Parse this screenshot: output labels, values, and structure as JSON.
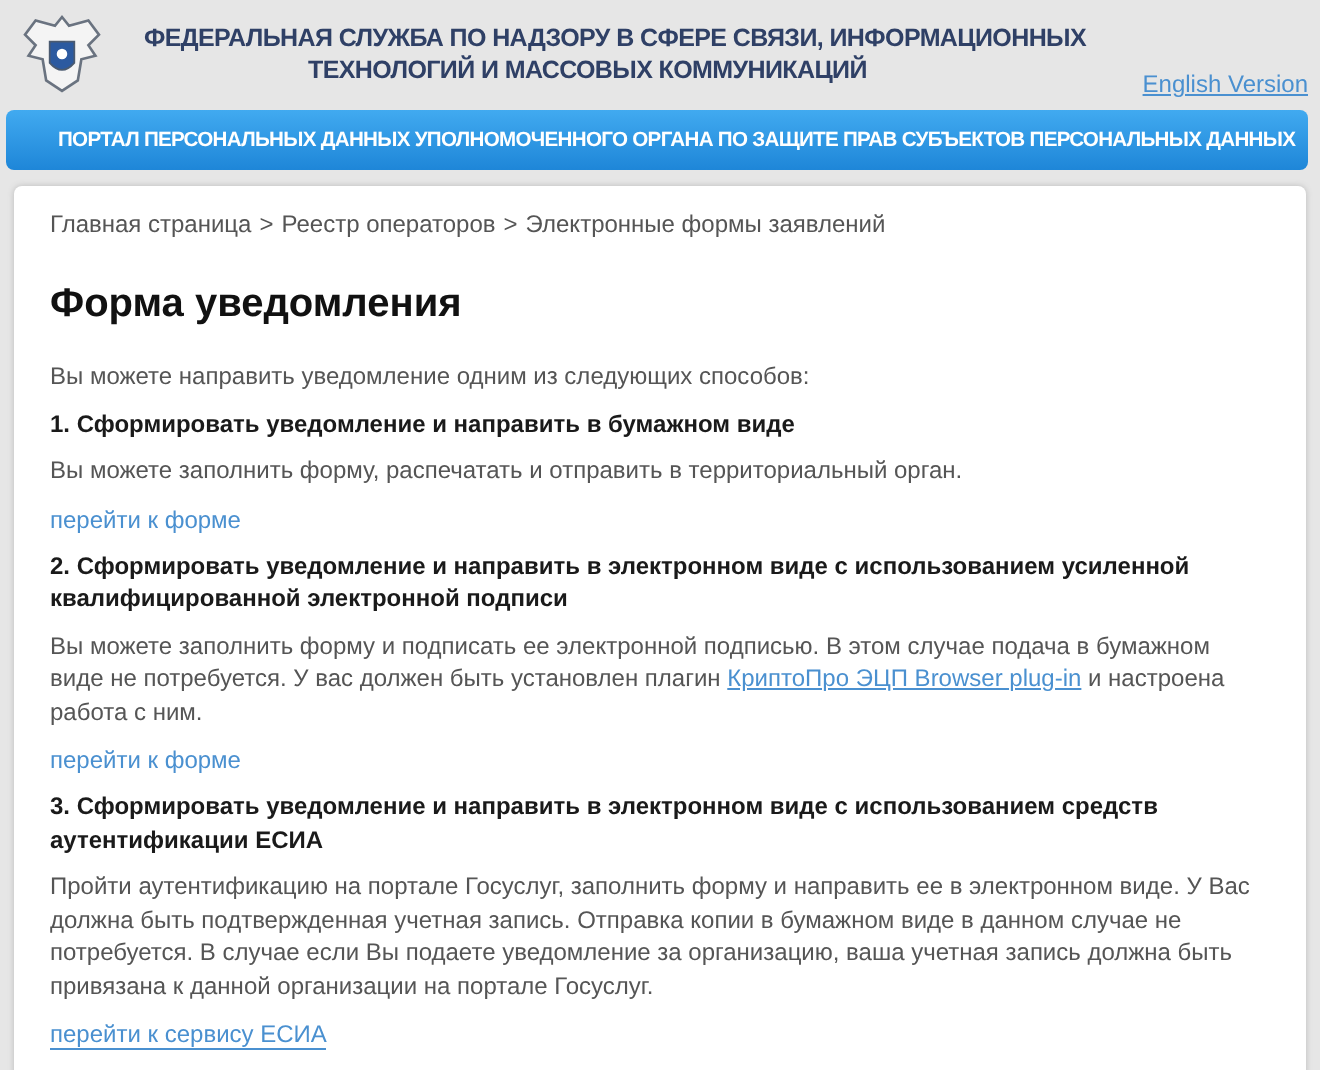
{
  "header": {
    "title_lines": [
      "ФЕДЕРАЛЬНАЯ СЛУЖБА ПО НАДЗОРУ В СФЕРЕ СВЯЗИ, ИНФОРМАЦИОННЫХ",
      "ТЕХНОЛОГИЙ И МАССОВЫХ КОММУНИКАЦИЙ"
    ],
    "language_link": "English Version"
  },
  "banner": "ПОРТАЛ ПЕРСОНАЛЬНЫХ ДАННЫХ УПОЛНОМОЧЕННОГО ОРГАНА ПО ЗАЩИТЕ ПРАВ СУБЪЕКТОВ ПЕРСОНАЛЬНЫХ ДАННЫХ",
  "breadcrumbs": [
    "Главная страница",
    "Реестр операторов",
    "Электронные формы заявлений"
  ],
  "breadcrumb_separator": ">",
  "page_title": "Форма уведомления",
  "intro": "Вы можете направить уведомление одним из следующих способов:",
  "sections": [
    {
      "title": "1. Сформировать уведомление и направить в бумажном виде",
      "text_before": "Вы можете заполнить форму, распечатать и отправить в территориальный орган.",
      "link": "перейти к форме",
      "link_underlined": false
    },
    {
      "title": "2. Сформировать уведомление и направить в электронном виде с использованием усиленной квалифицированной электронной подписи",
      "text_before": "Вы можете заполнить форму и подписать ее электронной подписью. В этом случае подача в бумажном виде не потребуется. У вас должен быть установлен плагин",
      "inline_link": "КриптоПро ЭЦП Browser plug-in",
      "text_after": "и настроена работа с ним.",
      "link": "перейти к форме",
      "link_underlined": false
    },
    {
      "title": "3. Сформировать уведомление и направить в электронном виде с использованием средств аутентификации ЕСИА",
      "text_before": "Пройти аутентификацию на портале Госуслуг, заполнить форму и направить ее в электронном виде. У Вас должна быть подтвержденная учетная запись. Отправка копии в бумажном виде в данном случае не потребуется. В случае если Вы подаете уведомление за организацию, ваша учетная запись должна быть привязана к данной организации на портале Госуслуг.",
      "link": "перейти к сервису ЕСИА",
      "link_underlined": true
    }
  ]
}
